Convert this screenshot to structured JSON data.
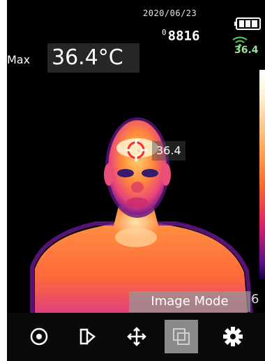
{
  "status": {
    "date": "2020/06/23",
    "counter_prefix": "0",
    "counter": "8816",
    "right_temp": "36.4"
  },
  "readout": {
    "max_label": "Max",
    "max_value": "36.4°C",
    "spot_value": "36.4"
  },
  "mode": {
    "label": "Image Mode",
    "edge_digit": "6"
  },
  "toolbar": {
    "buttons": [
      {
        "icon": "target-icon",
        "selected": false
      },
      {
        "icon": "palette-icon",
        "selected": false
      },
      {
        "icon": "move-icon",
        "selected": false
      },
      {
        "icon": "image-mode-icon",
        "selected": true
      },
      {
        "icon": "gear-icon",
        "selected": false
      }
    ]
  },
  "colors": {
    "selected_button": "#8a8a8a",
    "temp_green": "#9be39b"
  }
}
